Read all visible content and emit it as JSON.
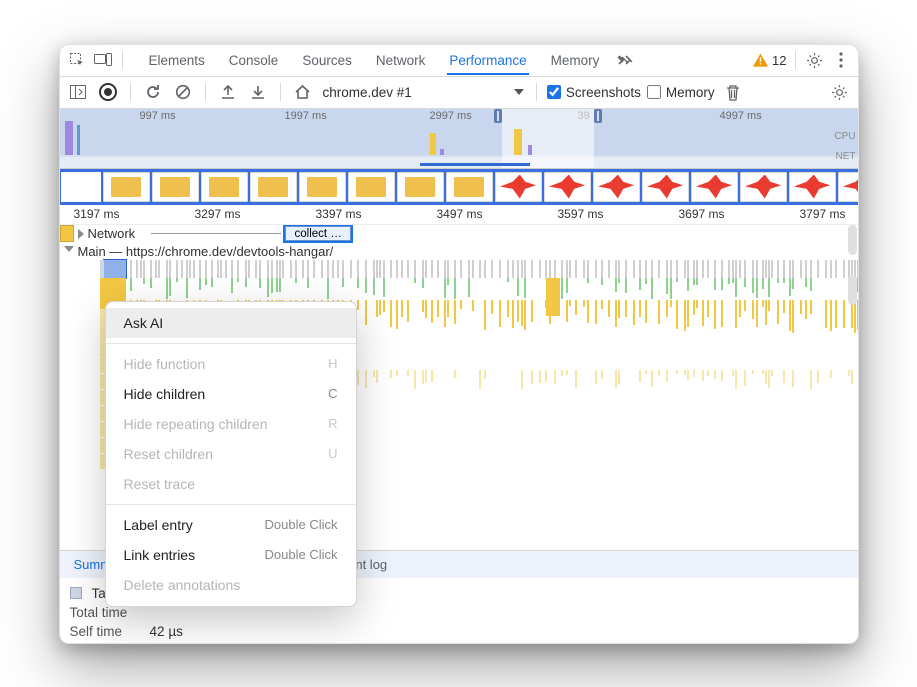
{
  "tabs": {
    "items": [
      "Elements",
      "Console",
      "Sources",
      "Network",
      "Performance",
      "Memory"
    ],
    "active": "Performance",
    "warn_count": "12"
  },
  "toolbar": {
    "target_label": "chrome.dev #1",
    "screenshots_label": "Screenshots",
    "screenshots_checked": true,
    "memory_label": "Memory",
    "memory_checked": false
  },
  "minimap": {
    "ticks": [
      "997 ms",
      "1997 ms",
      "2997 ms",
      "39",
      "4997 ms"
    ],
    "side_cpu": "CPU",
    "side_net": "NET"
  },
  "ruler": {
    "ticks": [
      "3197 ms",
      "3297 ms",
      "3397 ms",
      "3497 ms",
      "3597 ms",
      "3697 ms",
      "3797 ms"
    ]
  },
  "network": {
    "header": "Network",
    "collect_label": "collect …"
  },
  "main": {
    "header": "Main — https://chrome.dev/devtools-hangar/"
  },
  "context_menu": {
    "ask_ai": "Ask AI",
    "hide_function": "Hide function",
    "hide_function_key": "H",
    "hide_children": "Hide children",
    "hide_children_key": "C",
    "hide_repeating": "Hide repeating children",
    "hide_repeating_key": "R",
    "reset_children": "Reset children",
    "reset_children_key": "U",
    "reset_trace": "Reset trace",
    "label_entry": "Label entry",
    "label_entry_hint": "Double Click",
    "link_entries": "Link entries",
    "link_entries_hint": "Double Click",
    "delete_annotations": "Delete annotations"
  },
  "bottom_tabs": {
    "items": [
      "Summary",
      "",
      "ent log"
    ],
    "active": "Summary"
  },
  "details": {
    "task_label": "Task",
    "total_time_label": "Total time",
    "self_time_label": "Self time",
    "self_time_value": "42 µs"
  }
}
